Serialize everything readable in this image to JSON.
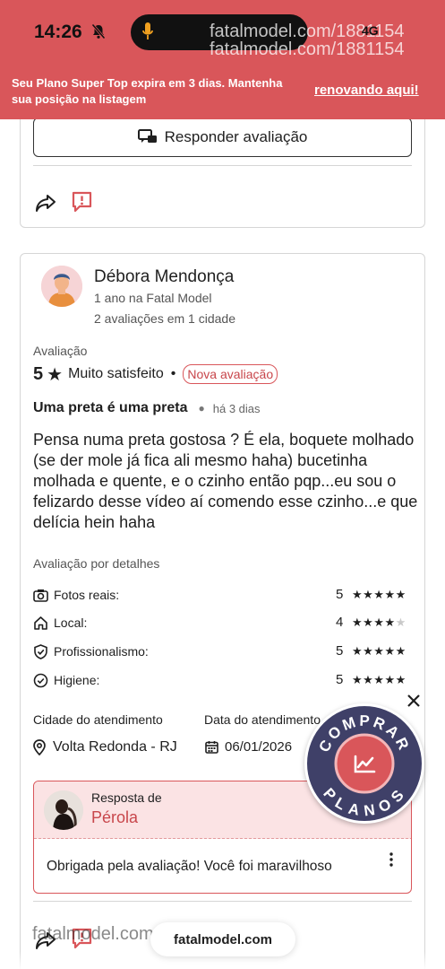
{
  "status_bar": {
    "time": "14:26",
    "network": "4G",
    "watermark_1": "fatalmodel.com/1881154",
    "watermark_2": "fatalmodel.com/1881154"
  },
  "banner": {
    "message": "Seu Plano Super Top expira em 3 dias. Mantenha sua posição na listagem",
    "link_label": "renovando aqui!",
    "color": "#d9565a"
  },
  "previous_review": {
    "reply_button_label": "Responder avaliação"
  },
  "review": {
    "author_name": "Débora Mendonça",
    "member_since": "1 ano na Fatal Model",
    "reviews_summary": "2 avaliações em 1 cidade",
    "rating_label": "Avaliação",
    "rating_value": "5",
    "rating_text": "Muito satisfeito",
    "new_badge": "Nova avaliação",
    "title": "Uma preta é uma preta",
    "time_ago": "há 3 dias",
    "body": "Pensa numa preta gostosa ? É ela, boquete molhado (se der mole já fica ali mesmo haha) bucetinha molhada e quente, e o czinho então pqp...eu sou o felizardo desse vídeo aí comendo esse czinho...e que delícia hein haha",
    "details_label": "Avaliação por detalhes",
    "details": [
      {
        "label": "Fotos reais:",
        "score": "5",
        "stars": 5,
        "icon": "camera-check-icon"
      },
      {
        "label": "Local:",
        "score": "4",
        "stars": 4,
        "icon": "home-icon"
      },
      {
        "label": "Profissionalismo:",
        "score": "5",
        "stars": 5,
        "icon": "shield-check-icon"
      },
      {
        "label": "Higiene:",
        "score": "5",
        "stars": 5,
        "icon": "circle-check-icon"
      }
    ],
    "city_label": "Cidade do atendimento",
    "city_value": "Volta Redonda - RJ",
    "date_label": "Data do atendimento",
    "date_value": "06/01/2026"
  },
  "response": {
    "label": "Resposta de",
    "author": "Pérola",
    "text": "Obrigada pela avaliação! Você foi maravilhoso"
  },
  "promo": {
    "text_top": "COMPRAR",
    "text_bottom": "PLANOS",
    "color": "#3f4068",
    "accent": "#d9565a"
  },
  "bottom": {
    "watermark": "fatalmodel.com/1881154",
    "url": "fatalmodel.com"
  }
}
